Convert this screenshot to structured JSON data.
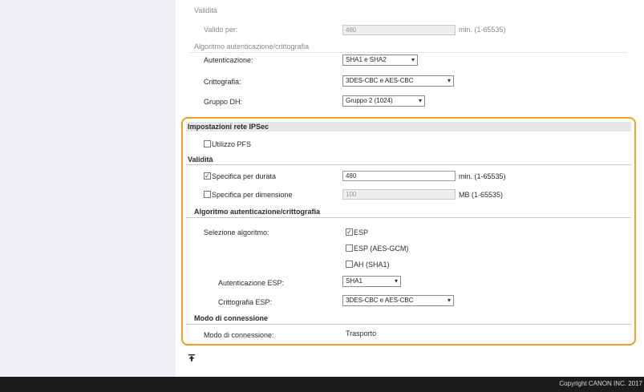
{
  "top_section": {
    "validity_title": "Validità",
    "valid_for_label": "Valido per:",
    "valid_for_value": "480",
    "valid_for_range": "min. (1-65535)",
    "auth_crypto_title": "Algoritmo autenticazione/crittografia",
    "authentication_label": "Autenticazione:",
    "authentication_value": "SHA1 e SHA2",
    "encryption_label": "Crittografia:",
    "encryption_value": "3DES-CBC e AES-CBC",
    "dh_group_label": "Gruppo DH:",
    "dh_group_value": "Gruppo 2 (1024)"
  },
  "ipsec": {
    "title": "Impostazioni rete IPSec",
    "use_pfs_label": "Utilizzo PFS",
    "use_pfs_checked": false,
    "validity_title": "Validità",
    "by_time_label": "Specifica per durata",
    "by_time_checked": true,
    "by_time_value": "480",
    "by_time_range": "min. (1-65535)",
    "by_size_label": "Specifica per dimensione",
    "by_size_checked": false,
    "by_size_value": "100",
    "by_size_range": "MB (1-65535)",
    "algo_title": "Algoritmo autenticazione/crittografia",
    "algo_select_label": "Selezione algoritmo:",
    "esp_label": "ESP",
    "esp_checked": true,
    "esp_aes_gcm_label": "ESP (AES-GCM)",
    "esp_aes_gcm_checked": false,
    "ah_sha1_label": "AH (SHA1)",
    "ah_sha1_checked": false,
    "esp_auth_label": "Autenticazione ESP:",
    "esp_auth_value": "SHA1",
    "esp_crypto_label": "Crittografia ESP:",
    "esp_crypto_value": "3DES-CBC e AES-CBC",
    "connection_mode_title": "Modo di connessione",
    "connection_mode_label": "Modo di connessione:",
    "connection_mode_value": "Trasporto"
  },
  "page_top_icon": "page-top-icon",
  "footer": {
    "copyright": "Copyright CANON INC. 2017"
  },
  "colors": {
    "highlight": "#f0a020",
    "footer_bg": "#1b1b1b",
    "left_panel_bg": "#eef0f5"
  }
}
